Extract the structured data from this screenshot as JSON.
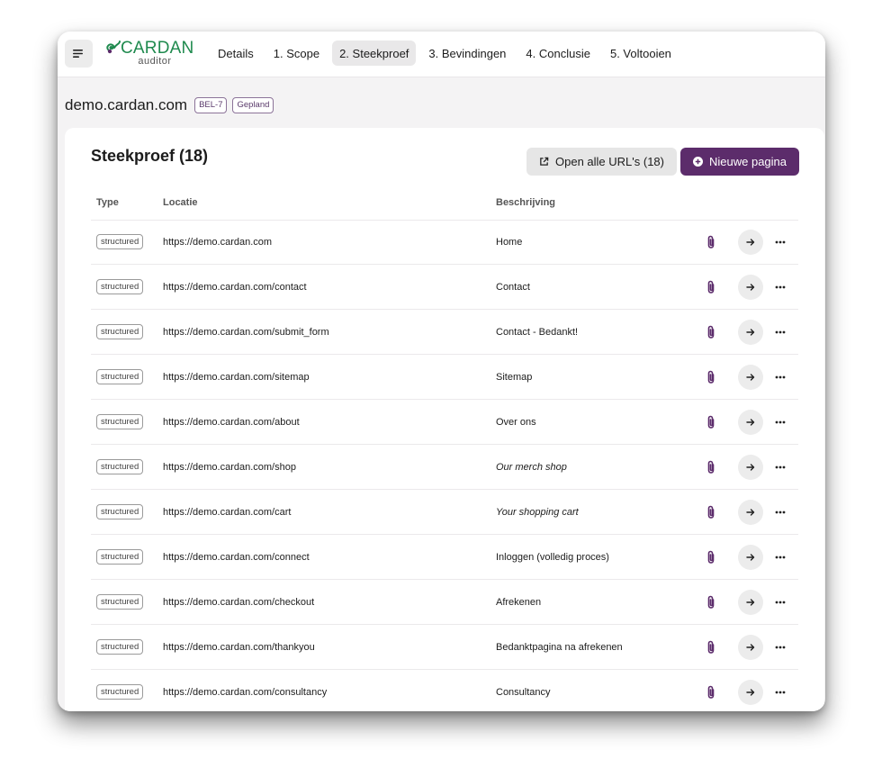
{
  "header": {
    "logo_word": "CARDAN",
    "logo_sub": "auditor",
    "tabs": [
      {
        "label": "Details",
        "active": false
      },
      {
        "label": "1. Scope",
        "active": false
      },
      {
        "label": "2. Steekproef",
        "active": true
      },
      {
        "label": "3. Bevindingen",
        "active": false
      },
      {
        "label": "4. Conclusie",
        "active": false
      },
      {
        "label": "5. Voltooien",
        "active": false
      }
    ]
  },
  "page": {
    "domain": "demo.cardan.com",
    "badges": [
      "BEL-7",
      "Gepland"
    ]
  },
  "card": {
    "title": "Steekproef (18)",
    "open_all_label": "Open alle URL's (18)",
    "new_page_label": "Nieuwe pagina"
  },
  "table": {
    "columns": [
      "Type",
      "Locatie",
      "Beschrijving"
    ],
    "rows": [
      {
        "type": "structured",
        "location": "https://demo.cardan.com",
        "description": "Home",
        "italic": false
      },
      {
        "type": "structured",
        "location": "https://demo.cardan.com/contact",
        "description": "Contact",
        "italic": false
      },
      {
        "type": "structured",
        "location": "https://demo.cardan.com/submit_form",
        "description": "Contact - Bedankt!",
        "italic": false
      },
      {
        "type": "structured",
        "location": "https://demo.cardan.com/sitemap",
        "description": "Sitemap",
        "italic": false
      },
      {
        "type": "structured",
        "location": "https://demo.cardan.com/about",
        "description": "Over ons",
        "italic": false
      },
      {
        "type": "structured",
        "location": "https://demo.cardan.com/shop",
        "description": "Our merch shop",
        "italic": true
      },
      {
        "type": "structured",
        "location": "https://demo.cardan.com/cart",
        "description": "Your shopping cart",
        "italic": true
      },
      {
        "type": "structured",
        "location": "https://demo.cardan.com/connect",
        "description": "Inloggen (volledig proces)",
        "italic": false
      },
      {
        "type": "structured",
        "location": "https://demo.cardan.com/checkout",
        "description": "Afrekenen",
        "italic": false
      },
      {
        "type": "structured",
        "location": "https://demo.cardan.com/thankyou",
        "description": "Bedanktpagina na afrekenen",
        "italic": false
      },
      {
        "type": "structured",
        "location": "https://demo.cardan.com/consultancy",
        "description": "Consultancy",
        "italic": false
      }
    ]
  },
  "icons": {
    "menu": "menu-icon",
    "logo": "cardan-logo-icon",
    "external": "external-link-icon",
    "add": "plus-circle-icon",
    "attachment": "paperclip-icon",
    "go": "arrow-right-icon",
    "more": "more-horizontal-icon"
  },
  "colors": {
    "brand_green": "#1f8a4e",
    "primary_purple": "#5c2c6b",
    "clip_purple": "#5c2c6b"
  }
}
